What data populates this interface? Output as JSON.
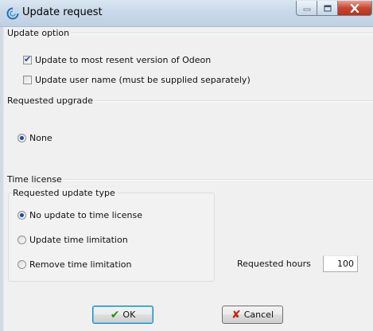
{
  "window": {
    "title": "Update request"
  },
  "update_option": {
    "label": "Update option",
    "options": [
      {
        "label": "Update to most resent version of Odeon",
        "checked": true
      },
      {
        "label": "Update user name (must be supplied separately)",
        "checked": false
      }
    ]
  },
  "requested_upgrade": {
    "label": "Requested upgrade",
    "options": [
      {
        "label": "None",
        "selected": true
      }
    ]
  },
  "time_license": {
    "label": "Time license",
    "update_type": {
      "label": "Requested update type",
      "options": [
        {
          "label": "No update to time license",
          "selected": true
        },
        {
          "label": "Update time limitation",
          "selected": false
        },
        {
          "label": "Remove time limitation",
          "selected": false
        }
      ]
    },
    "hours": {
      "label": "Requested hours",
      "value": "100"
    }
  },
  "buttons": {
    "ok_label": "OK",
    "cancel_label": "Cancel"
  },
  "colors": {
    "titlebar": "#c9d9ea",
    "close_button": "#c8462f",
    "radio_selected": "#1b4c97",
    "ok_icon": "#2e8b1e",
    "cancel_icon": "#c0261a"
  }
}
